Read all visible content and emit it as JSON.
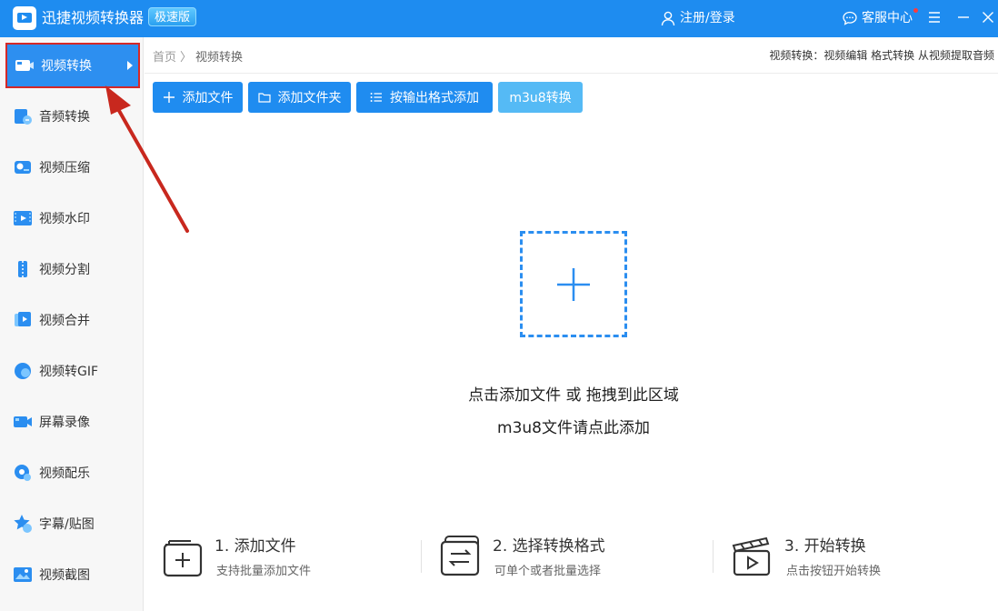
{
  "app": {
    "title": "迅捷视频转换器",
    "edition": "极速版",
    "login_label": "注册/登录",
    "service_label": "客服中心"
  },
  "sidebar": {
    "items": [
      {
        "label": "视频转换",
        "icon": "video-convert-icon",
        "active": true
      },
      {
        "label": "音频转换",
        "icon": "audio-convert-icon"
      },
      {
        "label": "视频压缩",
        "icon": "video-compress-icon"
      },
      {
        "label": "视频水印",
        "icon": "video-watermark-icon"
      },
      {
        "label": "视频分割",
        "icon": "video-split-icon"
      },
      {
        "label": "视频合并",
        "icon": "video-merge-icon"
      },
      {
        "label": "视频转GIF",
        "icon": "video-gif-icon"
      },
      {
        "label": "屏幕录像",
        "icon": "screen-record-icon"
      },
      {
        "label": "视频配乐",
        "icon": "video-music-icon"
      },
      {
        "label": "字幕/贴图",
        "icon": "subtitle-sticker-icon"
      },
      {
        "label": "视频截图",
        "icon": "video-screenshot-icon"
      }
    ]
  },
  "header": {
    "breadcrumb_home": "首页",
    "breadcrumb_sep": "〉",
    "breadcrumb_current": "视频转换",
    "right_text": "视频转换：视频编辑 格式转换 从视频提取音频"
  },
  "toolbar": {
    "add_file": "添加文件",
    "add_folder": "添加文件夹",
    "add_by_format": "按输出格式添加",
    "m3u8": "m3u8转换"
  },
  "dropzone": {
    "line1": "点击添加文件 或 拖拽到此区域",
    "line2": "m3u8文件请点此添加"
  },
  "steps": [
    {
      "title": "1. 添加文件",
      "desc": "支持批量添加文件",
      "icon": "add-file-step-icon"
    },
    {
      "title": "2. 选择转换格式",
      "desc": "可单个或者批量选择",
      "icon": "select-format-step-icon"
    },
    {
      "title": "3. 开始转换",
      "desc": "点击按钮开始转换",
      "icon": "start-convert-step-icon"
    }
  ],
  "colors": {
    "primary": "#1e8cf0",
    "primary_light": "#55baf5",
    "annotation_red": "#c8281e"
  }
}
